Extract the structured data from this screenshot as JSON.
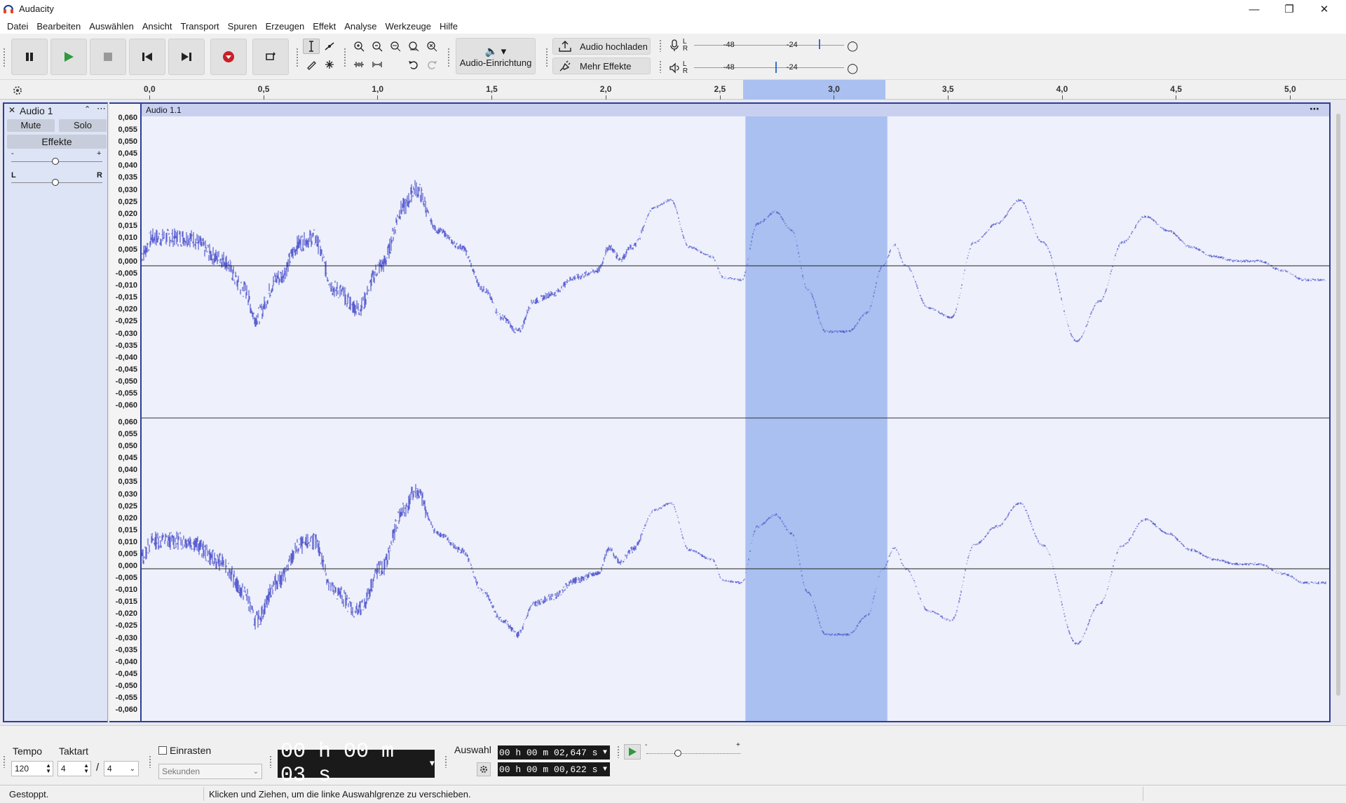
{
  "window": {
    "title": "Audacity"
  },
  "menu": [
    "Datei",
    "Bearbeiten",
    "Auswählen",
    "Ansicht",
    "Transport",
    "Spuren",
    "Erzeugen",
    "Effekt",
    "Analyse",
    "Werkzeuge",
    "Hilfe"
  ],
  "toolbar": {
    "audio_setup_label": "Audio-Einrichtung",
    "upload_label": "Audio hochladen",
    "more_effects_label": "Mehr Effekte",
    "rec_meter": {
      "l": "L",
      "r": "R",
      "marks": [
        "-48",
        "-24"
      ]
    },
    "play_meter": {
      "l": "L",
      "r": "R",
      "marks": [
        "-48",
        "-24"
      ]
    }
  },
  "ruler": {
    "ticks": [
      "0,0",
      "0,5",
      "1,0",
      "1,5",
      "2,0",
      "2,5",
      "3,0",
      "3,5",
      "4,0",
      "4,5",
      "5,0"
    ]
  },
  "track": {
    "name": "Audio 1",
    "mute": "Mute",
    "solo": "Solo",
    "effects": "Effekte",
    "gain_minus": "-",
    "gain_plus": "+",
    "pan_l": "L",
    "pan_r": "R",
    "clip_name": "Audio 1.1",
    "scale_labels": [
      "0,060",
      "0,055",
      "0,050",
      "0,045",
      "0,040",
      "0,035",
      "0,030",
      "0,025",
      "0,020",
      "0,015",
      "0,010",
      "0,005",
      "0,000",
      "-0,005",
      "-0,010",
      "-0,015",
      "-0,020",
      "-0,025",
      "-0,030",
      "-0,035",
      "-0,040",
      "-0,045",
      "-0,050",
      "-0,055",
      "-0,060"
    ],
    "selection_seconds": [
      2.647,
      3.269
    ],
    "accent_color": "#5a5fd0",
    "selection_color": "#a9c0f0"
  },
  "bottom": {
    "tempo_label": "Tempo",
    "tempo_value": "120",
    "time_sig_label": "Taktart",
    "time_sig_num": "4",
    "time_sig_sep": "/",
    "time_sig_den": "4",
    "snap_label": "Einrasten",
    "snap_unit": "Sekunden",
    "time_display": "00 h 00 m 03 s",
    "selection_label": "Auswahl",
    "sel_start": "00 h 00 m 02,647 s",
    "sel_length": "00 h 00 m 00,622 s",
    "speed_minus": "-",
    "speed_plus": "+"
  },
  "status": {
    "state": "Gestoppt.",
    "hint": "Klicken und Ziehen, um die linke Auswahlgrenze zu verschieben."
  }
}
